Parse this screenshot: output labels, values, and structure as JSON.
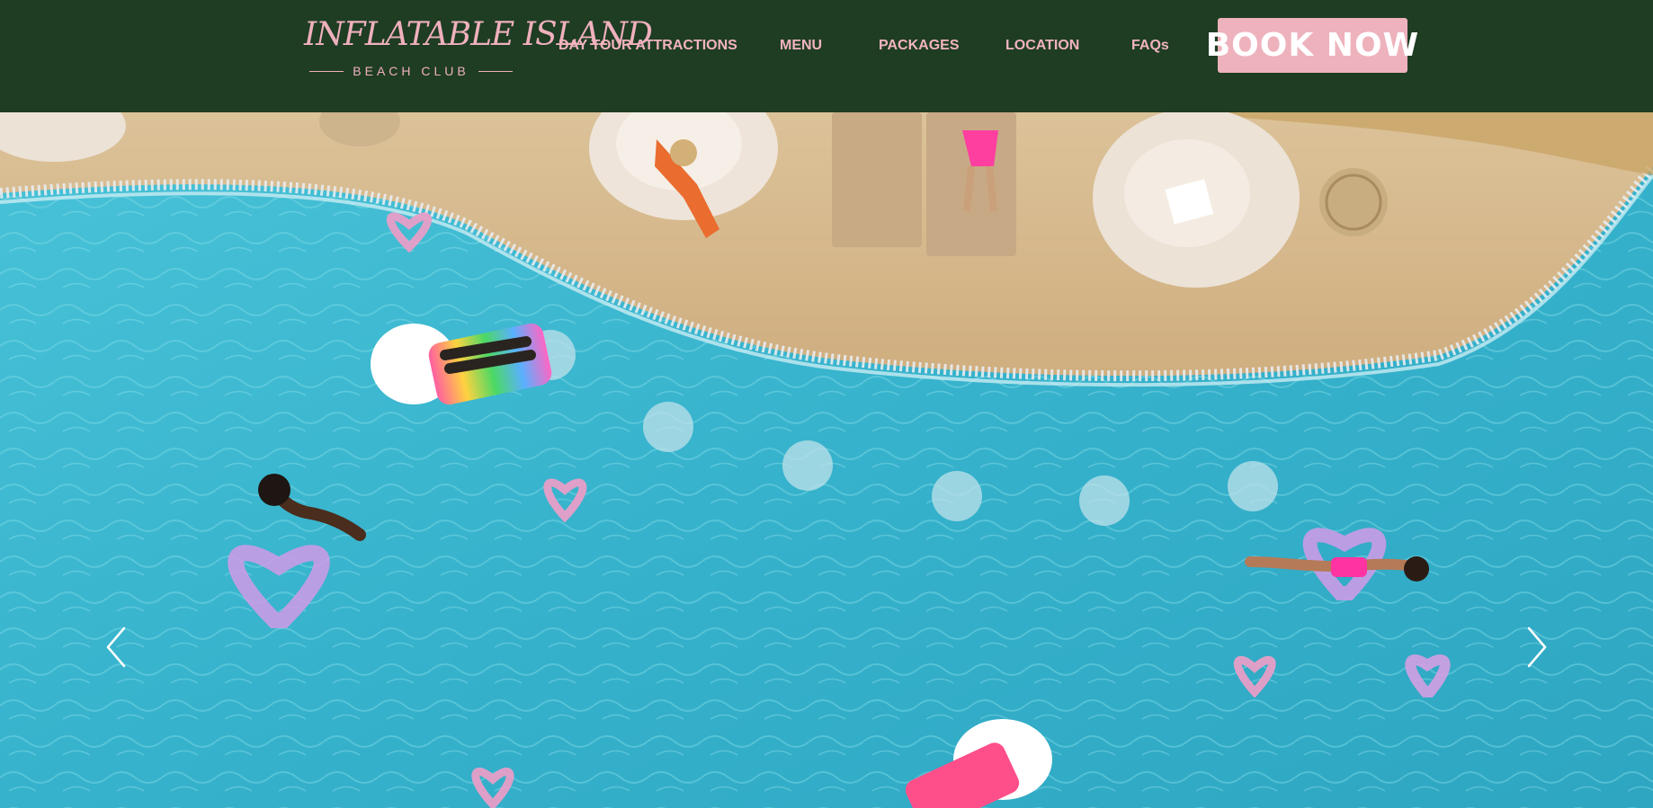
{
  "brand": {
    "name_line1": "INFLATABLE ISLAND",
    "name_line2": "BEACH CLUB"
  },
  "nav": {
    "items": [
      "DAY TOUR ATTRACTIONS",
      "MENU",
      "PACKAGES",
      "LOCATION",
      "FAQs"
    ],
    "cta_label": "BOOK NOW"
  },
  "colors": {
    "header_bg": "#1e3d23",
    "nav_text": "#f2b3c0",
    "cta_bg": "#eeb2bd",
    "pool_water": "#3fb9d2",
    "deck_wood": "#d7b98e"
  },
  "hero": {
    "image_subject": "aerial view of pool with inflatable floats",
    "prev_icon": "chevron-left-icon",
    "next_icon": "chevron-right-icon"
  }
}
